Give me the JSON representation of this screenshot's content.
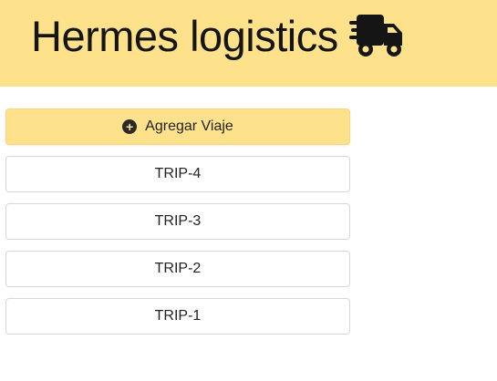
{
  "header": {
    "title": "Hermes logistics",
    "logo_icon": "truck-fast-icon",
    "background": "#fee18b"
  },
  "actions": {
    "add_trip_label": "Agregar Viaje",
    "add_icon": "plus-circle-icon"
  },
  "trips": [
    {
      "label": "TRIP-4"
    },
    {
      "label": "TRIP-3"
    },
    {
      "label": "TRIP-2"
    },
    {
      "label": "TRIP-1"
    }
  ]
}
